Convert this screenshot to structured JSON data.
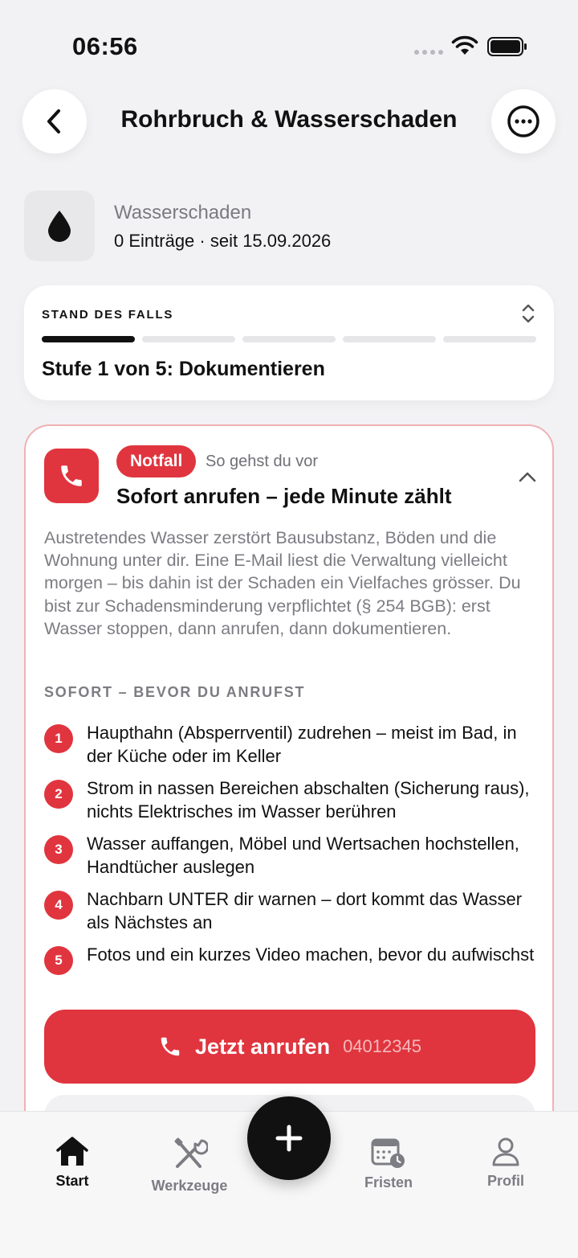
{
  "status_bar": {
    "time": "06:56"
  },
  "header": {
    "title": "Rohrbruch & Wasserschaden",
    "back_icon": "chevron-left-icon",
    "more_icon": "ellipsis-circle-icon"
  },
  "category": {
    "icon": "water-drop-icon",
    "name": "Wasserschaden",
    "meta": "0 Einträge · seit 15.09.2026"
  },
  "progress": {
    "label": "STAND DES FALLS",
    "current_step": 1,
    "total_steps": 5,
    "step_text": "Stufe 1 von 5: Dokumentieren"
  },
  "emergency": {
    "badge": "Notfall",
    "subtitle": "So gehst du vor",
    "title": "Sofort anrufen – jede Minute zählt",
    "description": "Austretendes Wasser zerstört Bausubstanz, Böden und die Wohnung unter dir. Eine E-Mail liest die Verwaltung vielleicht morgen – bis dahin ist der Schaden ein Vielfaches grösser. Du bist zur Schadensminderung verpflichtet (§ 254 BGB): erst Wasser stoppen, dann anrufen, dann dokumentieren.",
    "section_label": "SOFORT – BEVOR DU ANRUFST",
    "steps": [
      {
        "num": "1",
        "text": "Haupthahn (Absperrventil) zudrehen – meist im Bad, in der Küche oder im Keller"
      },
      {
        "num": "2",
        "text": "Strom in nassen Bereichen abschalten (Sicherung raus), nichts Elektrisches im Wasser berühren"
      },
      {
        "num": "3",
        "text": "Wasser auffangen, Möbel und Wertsachen hochstellen, Handtücher auslegen"
      },
      {
        "num": "4",
        "text": "Nachbarn UNTER dir warnen – dort kommt das Wasser als Nächstes an"
      },
      {
        "num": "5",
        "text": "Fotos und ein kurzes Video machen, bevor du aufwischst"
      }
    ],
    "call_button": {
      "label": "Jetzt anrufen",
      "number": "04012345"
    },
    "accent_color": "#e0353e"
  },
  "tab_bar": {
    "tabs": [
      {
        "label": "Start",
        "icon": "house-icon",
        "active": true
      },
      {
        "label": "Werkzeuge",
        "icon": "tools-icon",
        "active": false
      },
      {
        "label": "Fristen",
        "icon": "calendar-clock-icon",
        "active": false
      },
      {
        "label": "Profil",
        "icon": "person-icon",
        "active": false
      }
    ],
    "fab_icon": "plus-icon"
  }
}
